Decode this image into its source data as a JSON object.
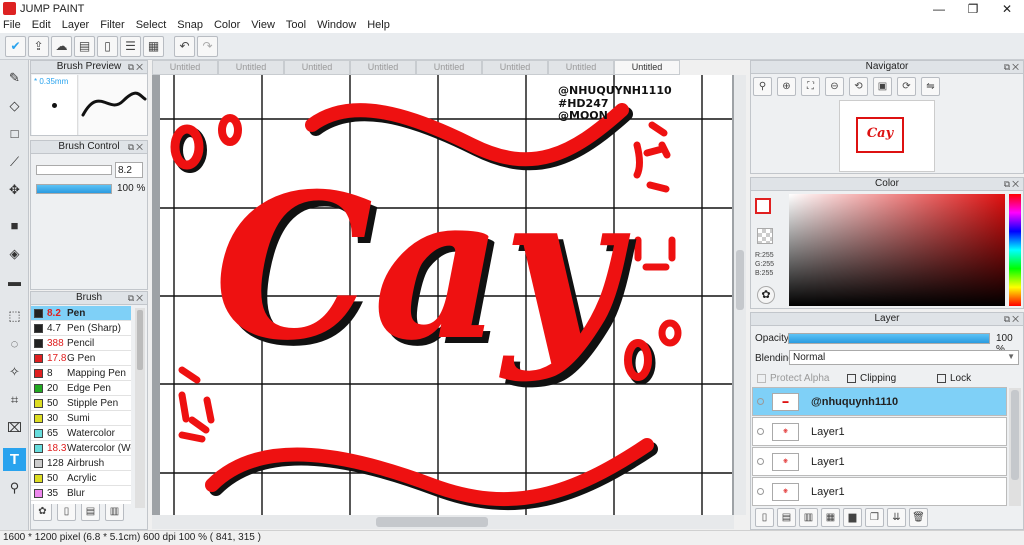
{
  "app": {
    "title": "JUMP PAINT",
    "accent": "#29a3ee"
  },
  "menu": [
    "File",
    "Edit",
    "Layer",
    "Filter",
    "Select",
    "Snap",
    "Color",
    "View",
    "Tool",
    "Window",
    "Help"
  ],
  "tabs": [
    "Untitled",
    "Untitled",
    "Untitled",
    "Untitled",
    "Untitled",
    "Untitled",
    "Untitled",
    "Untitled"
  ],
  "brush_preview": {
    "title": "Brush Preview",
    "size_label": "* 0.35mm"
  },
  "brush_control": {
    "title": "Brush Control",
    "size": "8.2",
    "opacity": "100 %"
  },
  "brush_panel": {
    "title": "Brush",
    "items": [
      {
        "size": "8.2",
        "name": "Pen",
        "color": "#222222",
        "size_color": "#e02020",
        "selected": true
      },
      {
        "size": "4.7",
        "name": "Pen (Sharp)",
        "color": "#222222",
        "size_color": "#222222"
      },
      {
        "size": "388",
        "name": "Pencil",
        "color": "#222222",
        "size_color": "#e02020"
      },
      {
        "size": "17.8",
        "name": "G Pen",
        "color": "#e02020",
        "size_color": "#e02020"
      },
      {
        "size": "8",
        "name": "Mapping Pen",
        "color": "#e02020",
        "size_color": "#222222"
      },
      {
        "size": "20",
        "name": "Edge Pen",
        "color": "#22aa22",
        "size_color": "#222222"
      },
      {
        "size": "50",
        "name": "Stipple Pen",
        "color": "#dddd22",
        "size_color": "#222222"
      },
      {
        "size": "30",
        "name": "Sumi",
        "color": "#dddd22",
        "size_color": "#222222"
      },
      {
        "size": "65",
        "name": "Watercolor",
        "color": "#66dddd",
        "size_color": "#222222"
      },
      {
        "size": "18.3",
        "name": "Watercolor (We",
        "color": "#66dddd",
        "size_color": "#e02020"
      },
      {
        "size": "128",
        "name": "Airbrush",
        "color": "#cccccc",
        "size_color": "#222222"
      },
      {
        "size": "50",
        "name": "Acrylic",
        "color": "#dddd22",
        "size_color": "#222222"
      },
      {
        "size": "35",
        "name": "Blur",
        "color": "#ee88ee",
        "size_color": "#222222"
      }
    ]
  },
  "artwork": {
    "main_text": "Cay",
    "credit_lines": [
      "@NHUQUYNH1110",
      "#HD247",
      "@MOON"
    ],
    "ink_color": "#ee1111"
  },
  "navigator": {
    "title": "Navigator"
  },
  "color": {
    "title": "Color",
    "r": "R:255",
    "g": "G:255",
    "b": "B:255"
  },
  "layer": {
    "title": "Layer",
    "opacity_label": "Opacity",
    "opacity_value": "100 %",
    "blending_label": "Blending",
    "blending_value": "Normal",
    "protect_alpha": "Protect Alpha",
    "clipping": "Clipping",
    "lock": "Lock",
    "rows": [
      {
        "name": "@nhuquynh1110",
        "thumb": "text",
        "selected": true
      },
      {
        "name": "Layer1",
        "thumb": "cay"
      },
      {
        "name": "Layer1",
        "thumb": "cay"
      },
      {
        "name": "Layer1",
        "thumb": "cay"
      }
    ]
  },
  "status": {
    "text": "1600 * 1200 pixel   (6.8 * 5.1cm)   600 dpi   100 %    ( 841, 315 )"
  }
}
